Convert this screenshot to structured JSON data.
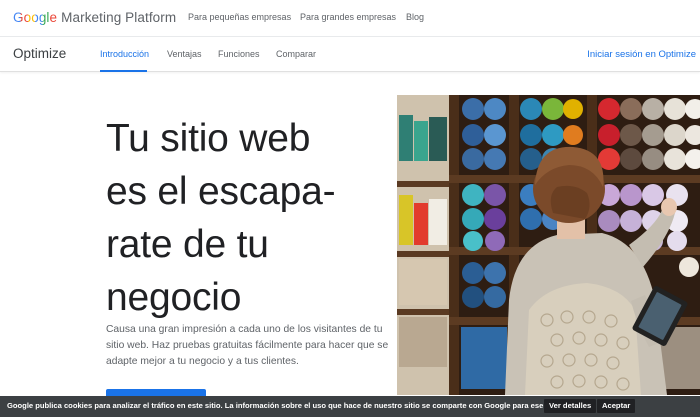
{
  "header": {
    "logo_google": "Google",
    "logo_rest": "Marketing Platform",
    "nav": [
      "Para pequeñas empresas",
      "Para grandes empresas",
      "Blog"
    ]
  },
  "subheader": {
    "product": "Optimize",
    "tabs": [
      "Introducción",
      "Ventajas",
      "Funciones",
      "Comparar"
    ],
    "active_tab": "Introducción",
    "signin": "Iniciar sesión en Optimize"
  },
  "hero": {
    "headline_lines": [
      "Tu sitio web",
      "es el escapa-",
      "rate de tu",
      "negocio"
    ],
    "subcopy": "Causa una gran impresión a cada uno de los visitantes de tu sitio web. Haz pruebas gratuitas fácilmente para hacer que se adapte mejor a tu negocio y a tus clientes."
  },
  "cookie_bar": {
    "text": "Google publica cookies para analizar el tráfico en este sitio. La información sobre el uso que hace de nuestro sitio se comparte con Google para ese fin.",
    "details_button": "Ver detalles",
    "accept_button": "Aceptar"
  },
  "colors": {
    "accent": "#1a73e8",
    "text": "#202124",
    "muted": "#5f6368",
    "cookie_bg": "#3c4043"
  }
}
